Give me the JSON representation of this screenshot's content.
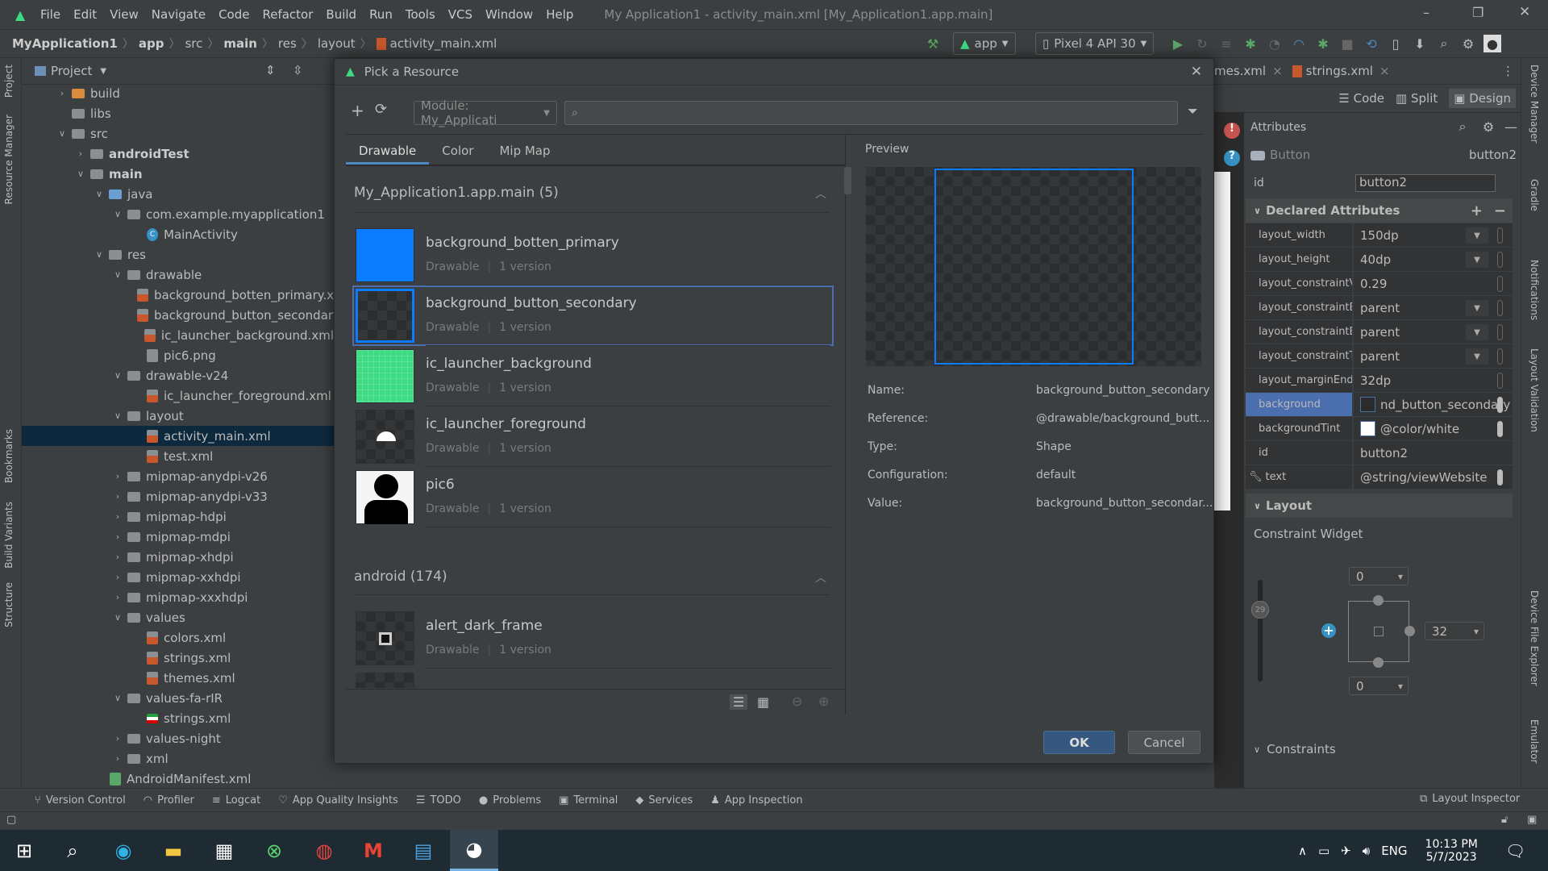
{
  "window": {
    "title": "My Application1 - activity_main.xml [My_Application1.app.main]",
    "menu": [
      "File",
      "Edit",
      "View",
      "Navigate",
      "Code",
      "Refactor",
      "Build",
      "Run",
      "Tools",
      "VCS",
      "Window",
      "Help"
    ]
  },
  "breadcrumb": [
    "MyApplication1",
    "app",
    "src",
    "main",
    "res",
    "layout",
    "activity_main.xml"
  ],
  "toolbar": {
    "run_config": "app",
    "device": "Pixel 4 API 30"
  },
  "left_stripe": [
    "Project",
    "Resource Manager",
    "Bookmarks",
    "Build Variants",
    "Structure"
  ],
  "right_stripe": [
    "Device Manager",
    "Gradle",
    "Notifications",
    "Layout Validation",
    "Device File Explorer",
    "Emulator"
  ],
  "project": {
    "header": "Project",
    "tree": [
      {
        "t": "build",
        "d": 0,
        "a": "r",
        "i": "folder-orange"
      },
      {
        "t": "libs",
        "d": 0,
        "a": "",
        "i": "folder"
      },
      {
        "t": "src",
        "d": 0,
        "a": "d",
        "i": "folder"
      },
      {
        "t": "androidTest",
        "d": 1,
        "a": "r",
        "i": "folder",
        "b": true
      },
      {
        "t": "main",
        "d": 1,
        "a": "d",
        "i": "folder",
        "b": true
      },
      {
        "t": "java",
        "d": 2,
        "a": "d",
        "i": "folder-blue"
      },
      {
        "t": "com.example.myapplication1",
        "d": 3,
        "a": "d",
        "i": "package"
      },
      {
        "t": "MainActivity",
        "d": 4,
        "a": "",
        "i": "class"
      },
      {
        "t": "res",
        "d": 2,
        "a": "d",
        "i": "folder"
      },
      {
        "t": "drawable",
        "d": 3,
        "a": "d",
        "i": "folder"
      },
      {
        "t": "background_botten_primary.xml",
        "d": 4,
        "a": "",
        "i": "xml"
      },
      {
        "t": "background_button_secondary.xml",
        "d": 4,
        "a": "",
        "i": "xml"
      },
      {
        "t": "ic_launcher_background.xml",
        "d": 4,
        "a": "",
        "i": "xml"
      },
      {
        "t": "pic6.png",
        "d": 4,
        "a": "",
        "i": "image"
      },
      {
        "t": "drawable-v24",
        "d": 3,
        "a": "d",
        "i": "folder"
      },
      {
        "t": "ic_launcher_foreground.xml",
        "d": 4,
        "a": "",
        "i": "xml"
      },
      {
        "t": "layout",
        "d": 3,
        "a": "d",
        "i": "folder"
      },
      {
        "t": "activity_main.xml",
        "d": 4,
        "a": "",
        "i": "xml",
        "s": true
      },
      {
        "t": "test.xml",
        "d": 4,
        "a": "",
        "i": "xml"
      },
      {
        "t": "mipmap-anydpi-v26",
        "d": 3,
        "a": "r",
        "i": "folder"
      },
      {
        "t": "mipmap-anydpi-v33",
        "d": 3,
        "a": "r",
        "i": "folder"
      },
      {
        "t": "mipmap-hdpi",
        "d": 3,
        "a": "r",
        "i": "folder"
      },
      {
        "t": "mipmap-mdpi",
        "d": 3,
        "a": "r",
        "i": "folder"
      },
      {
        "t": "mipmap-xhdpi",
        "d": 3,
        "a": "r",
        "i": "folder"
      },
      {
        "t": "mipmap-xxhdpi",
        "d": 3,
        "a": "r",
        "i": "folder"
      },
      {
        "t": "mipmap-xxxhdpi",
        "d": 3,
        "a": "r",
        "i": "folder"
      },
      {
        "t": "values",
        "d": 3,
        "a": "d",
        "i": "folder"
      },
      {
        "t": "colors.xml",
        "d": 4,
        "a": "",
        "i": "xml"
      },
      {
        "t": "strings.xml",
        "d": 4,
        "a": "",
        "i": "xml"
      },
      {
        "t": "themes.xml",
        "d": 4,
        "a": "",
        "i": "xml"
      },
      {
        "t": "values-fa-rIR",
        "d": 3,
        "a": "d",
        "i": "folder"
      },
      {
        "t": "strings.xml",
        "d": 4,
        "a": "",
        "i": "flag-iran"
      },
      {
        "t": "values-night",
        "d": 3,
        "a": "r",
        "i": "folder"
      },
      {
        "t": "xml",
        "d": 3,
        "a": "r",
        "i": "folder"
      },
      {
        "t": "AndroidManifest.xml",
        "d": 2,
        "a": "",
        "i": "manifest"
      }
    ]
  },
  "editor": {
    "tabs": [
      "mes.xml",
      "strings.xml"
    ],
    "modes": [
      "Code",
      "Split",
      "Design"
    ]
  },
  "dialog": {
    "title": "Pick a Resource",
    "module": "Module: My_Applicati",
    "search_placeholder": "",
    "tabs": [
      "Drawable",
      "Color",
      "Mip Map"
    ],
    "section1": "My_Application1.app.main (5)",
    "section2": "android (174)",
    "items": [
      {
        "name": "background_botten_primary",
        "type": "Drawable",
        "versions": "1 version",
        "thumb": "blue"
      },
      {
        "name": "background_button_secondary",
        "type": "Drawable",
        "versions": "1 version",
        "thumb": "shape",
        "selected": true
      },
      {
        "name": "ic_launcher_background",
        "type": "Drawable",
        "versions": "1 version",
        "thumb": "green"
      },
      {
        "name": "ic_launcher_foreground",
        "type": "Drawable",
        "versions": "1 version",
        "thumb": "android"
      },
      {
        "name": "pic6",
        "type": "Drawable",
        "versions": "1 version",
        "thumb": "person"
      }
    ],
    "android_items": [
      {
        "name": "alert_dark_frame",
        "type": "Drawable",
        "versions": "1 version",
        "thumb": "frame"
      }
    ],
    "preview_label": "Preview",
    "details": [
      {
        "k": "Name:",
        "v": "background_button_secondary"
      },
      {
        "k": "Reference:",
        "v": "@drawable/background_butt..."
      },
      {
        "k": "Type:",
        "v": "Shape"
      },
      {
        "k": "Configuration:",
        "v": "default"
      },
      {
        "k": "Value:",
        "v": "background_button_secondar..."
      }
    ],
    "ok": "OK",
    "cancel": "Cancel"
  },
  "attributes": {
    "title": "Attributes",
    "widget": "Button",
    "widget_id": "button2",
    "id_label": "id",
    "id_value": "button2",
    "declared": "Declared Attributes",
    "rows": [
      {
        "k": "layout_width",
        "v": "150dp",
        "dd": true
      },
      {
        "k": "layout_height",
        "v": "40dp",
        "dd": true
      },
      {
        "k": "layout_constraintV...",
        "v": "0.29"
      },
      {
        "k": "layout_constraintB...",
        "v": "parent",
        "dd": true
      },
      {
        "k": "layout_constraintE...",
        "v": "parent",
        "dd": true
      },
      {
        "k": "layout_constraintT...",
        "v": "parent",
        "dd": true
      },
      {
        "k": "layout_marginEnd",
        "v": "32dp"
      },
      {
        "k": "background",
        "v": "nd_button_secondary",
        "sw": "#2b2b2b",
        "sel": true,
        "f": true
      },
      {
        "k": "backgroundTint",
        "v": "@color/white",
        "sw": "#ffffff",
        "f": true
      },
      {
        "k": "id",
        "v": "button2",
        "nopill": true
      },
      {
        "k": "text",
        "v": "@string/viewWebsite",
        "f": true,
        "wrench": true
      }
    ],
    "layout_section": "Layout",
    "constraint_widget": "Constraint Widget",
    "bias": "29",
    "margin_top": "0",
    "margin_end": "32",
    "margin_bottom": "0",
    "constraints": "Constraints"
  },
  "bottom_tools": [
    "Version Control",
    "Profiler",
    "Logcat",
    "App Quality Insights",
    "TODO",
    "Problems",
    "Terminal",
    "Services",
    "App Inspection"
  ],
  "layout_inspector": "Layout Inspector",
  "taskbar": {
    "lang": "ENG",
    "time": "10:13 PM",
    "date": "5/7/2023"
  },
  "colors": {
    "accent": "#4a88c7",
    "selection": "#0d293e",
    "attr_selection": "#4b6eaf",
    "primary_drawable": "#0a7cff",
    "launcher_bg": "#3ddc84"
  }
}
